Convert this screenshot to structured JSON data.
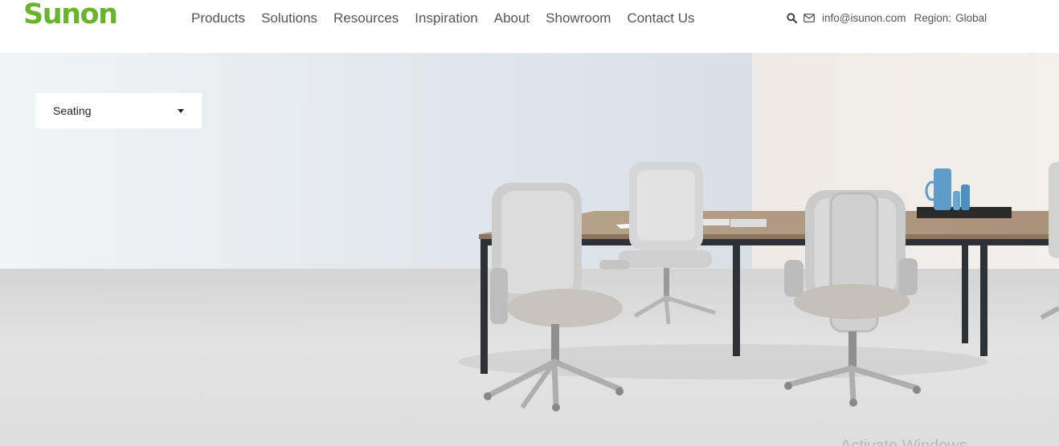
{
  "brand": {
    "logo_text": "Sunon",
    "color": "#6ab42d"
  },
  "nav": {
    "items": [
      {
        "label": "Products"
      },
      {
        "label": "Solutions"
      },
      {
        "label": "Resources"
      },
      {
        "label": "Inspiration"
      },
      {
        "label": "About"
      },
      {
        "label": "Showroom"
      },
      {
        "label": "Contact Us"
      }
    ]
  },
  "utility": {
    "search_icon": "search-icon",
    "mail_icon": "envelope-icon",
    "email": "info@isunon.com",
    "region_label": "Region:",
    "region_value": "Global"
  },
  "hero": {
    "dropdown": {
      "selected": "Seating"
    },
    "watermark": "Activate Windows"
  }
}
